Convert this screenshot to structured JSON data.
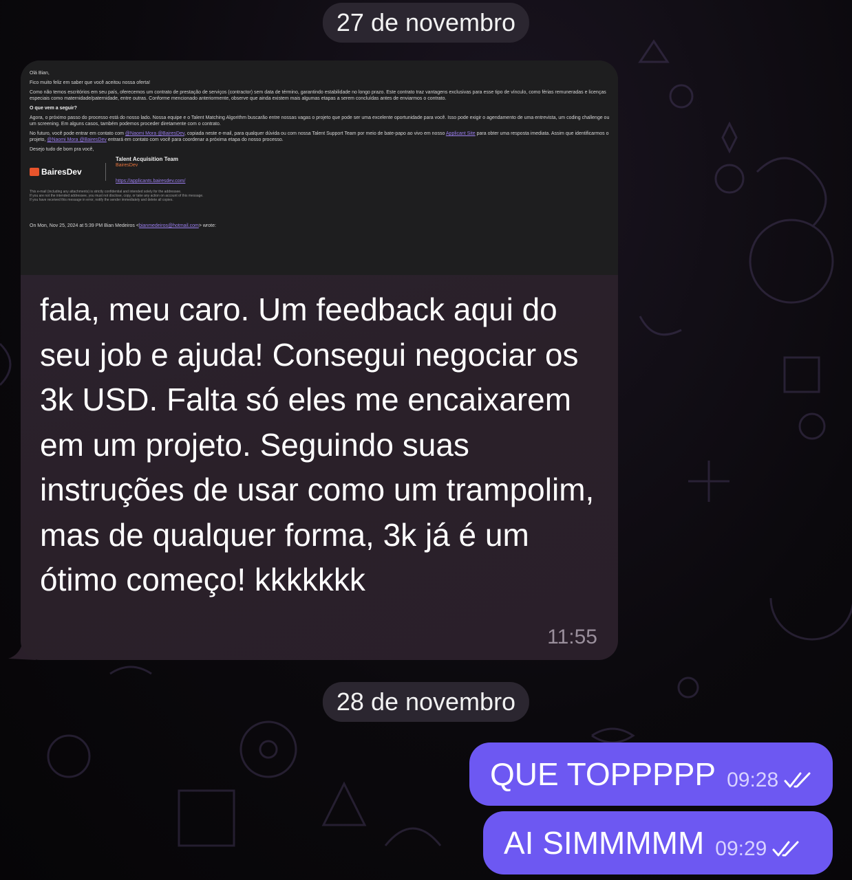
{
  "dates": [
    "27 de novembro",
    "28 de novembro"
  ],
  "incoming": {
    "email": {
      "greeting": "Olá Bian,",
      "intro": "Fico muito feliz em saber que você aceitou nossa oferta!",
      "paragraph1": "Como não temos escritórios em seu país, oferecemos um contrato de prestação de serviços (contractor) sem data de término, garantindo estabilidade no longo prazo. Este contrato traz vantagens exclusivas para esse tipo de vínculo, como férias remuneradas e licenças especiais como maternidade/paternidade, entre outras. Conforme mencionado anteriormente, observe que ainda existem mais algumas etapas a serem concluídas antes de enviarmos o contrato.",
      "heading": "O que vem a seguir?",
      "paragraph2": "Agora, o próximo passo do processo está do nosso lado. Nossa equipe e o Talent Matching Algorithm buscarão entre nossas vagas o projeto que pode ser uma excelente oportunidade para você. Isso pode exigir o agendamento de uma entrevista, um coding challenge ou um screening. Em alguns casos, também podemos proceder diretamente com o contrato.",
      "paragraph3_a": "No futuro, você pode entrar em contato com ",
      "mention1": "@Naomi Mora @BairesDev",
      "paragraph3_b": ", copiada neste e-mail, para qualquer dúvida ou com nossa Talent Support Team por meio de bate-papo ao vivo em nosso ",
      "site_link": "Applicant Site",
      "paragraph3_c": " para obter uma resposta imediata. Assim que identificarmos o projeto, ",
      "mention2": "@Naomi Mora @BairesDev",
      "paragraph3_d": " entrará em contato com você para coordenar a próxima etapa do nosso processo.",
      "closing": "Desejo tudo de bom pra você,",
      "logo_text": "BairesDev",
      "sig_team": "Talent Acquisition Team",
      "sig_company": "BairesDev",
      "sig_link": "https://applicants.bairesdev.com/",
      "disclaimer1": "This e-mail (including any attachments) is strictly confidential and intended solely for the addressee.",
      "disclaimer2": "If you are not the intended addressee, you must not disclose, copy, or take any action on account of this message.",
      "disclaimer3": "If you have received this message in error, notify the sender immediately and delete all copies.",
      "quote_a": "On Mon, Nov 25, 2024 at 5:39 PM Bian Medeiros <",
      "quote_email": "bianmedeiros@hotmail.com",
      "quote_b": "> wrote:"
    },
    "text": "fala, meu caro. Um feedback aqui do seu job e ajuda! Consegui negociar os 3k USD. Falta só eles me encaixarem em um projeto. Seguindo suas instruções de  usar como um trampolim, mas de qualquer forma, 3k já é um ótimo começo! kkkkkkk",
    "time": "11:55"
  },
  "outgoing": [
    {
      "text": "QUE TOPPPPP",
      "time": "09:28"
    },
    {
      "text": "AI SIMMMMM",
      "time": "09:29"
    }
  ],
  "colors": {
    "outgoing_bubble": "#6d58f2",
    "incoming_bubble": "#2a2029",
    "accent_orange": "#e8542c"
  }
}
